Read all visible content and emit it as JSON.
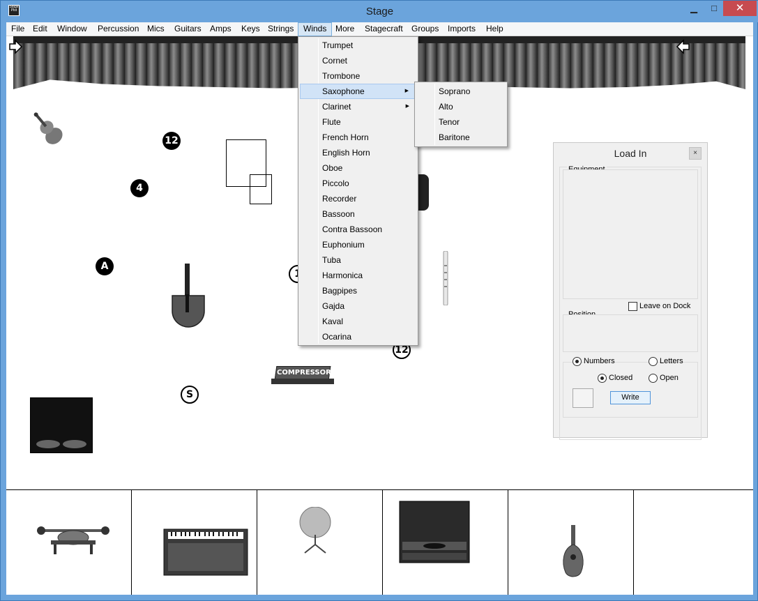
{
  "window": {
    "title": "Stage",
    "app_icon_text": "Stage Plot",
    "min_glyph": "▁",
    "max_glyph": "□",
    "close_glyph": "✕"
  },
  "menubar": [
    {
      "label": "File"
    },
    {
      "label": "Edit"
    },
    {
      "label": "Window"
    },
    {
      "label": "Percussion"
    },
    {
      "label": "Mics"
    },
    {
      "label": "Guitars"
    },
    {
      "label": "Amps"
    },
    {
      "label": "Keys"
    },
    {
      "label": "Strings"
    },
    {
      "label": "Winds"
    },
    {
      "label": "More"
    },
    {
      "label": "Stagecraft"
    },
    {
      "label": "Groups"
    },
    {
      "label": "Imports"
    },
    {
      "label": "Help"
    }
  ],
  "winds_menu": [
    "Trumpet",
    "Cornet",
    "Trombone",
    "Saxophone",
    "Clarinet",
    "Flute",
    "French Horn",
    "English Horn",
    "Oboe",
    "Piccolo",
    "Recorder",
    "Bassoon",
    "Contra Bassoon",
    "Euphonium",
    "Tuba",
    "Harmonica",
    "Bagpipes",
    "Gajda",
    "Kaval",
    "Ocarina"
  ],
  "saxophone_menu": [
    "Soprano",
    "Alto",
    "Tenor",
    "Baritone"
  ],
  "submenu_arrow": "▶",
  "stage": {
    "badges": [
      {
        "text": "12",
        "style": "filled"
      },
      {
        "text": "4",
        "style": "filled"
      },
      {
        "text": "A",
        "style": "filled"
      },
      {
        "text": "1",
        "style": "outline"
      },
      {
        "text": "12",
        "style": "outline"
      },
      {
        "text": "S",
        "style": "outline"
      }
    ],
    "compressor_label": "COMPRESSOR"
  },
  "loadin": {
    "title": "Load In",
    "close_glyph": "×",
    "equipment_label": "Equipment",
    "leave_on_dock_label": "Leave on Dock",
    "position_label": "Position",
    "numbers_label": "Numbers",
    "letters_label": "Letters",
    "closed_label": "Closed",
    "open_label": "Open",
    "write_label": "Write"
  },
  "palette": {
    "items": [
      "drum-pedal-icon",
      "keyboard-amp-icon",
      "cymbal-stand-icon",
      "bass-cabinet-icon",
      "mandolin-icon",
      ""
    ]
  }
}
